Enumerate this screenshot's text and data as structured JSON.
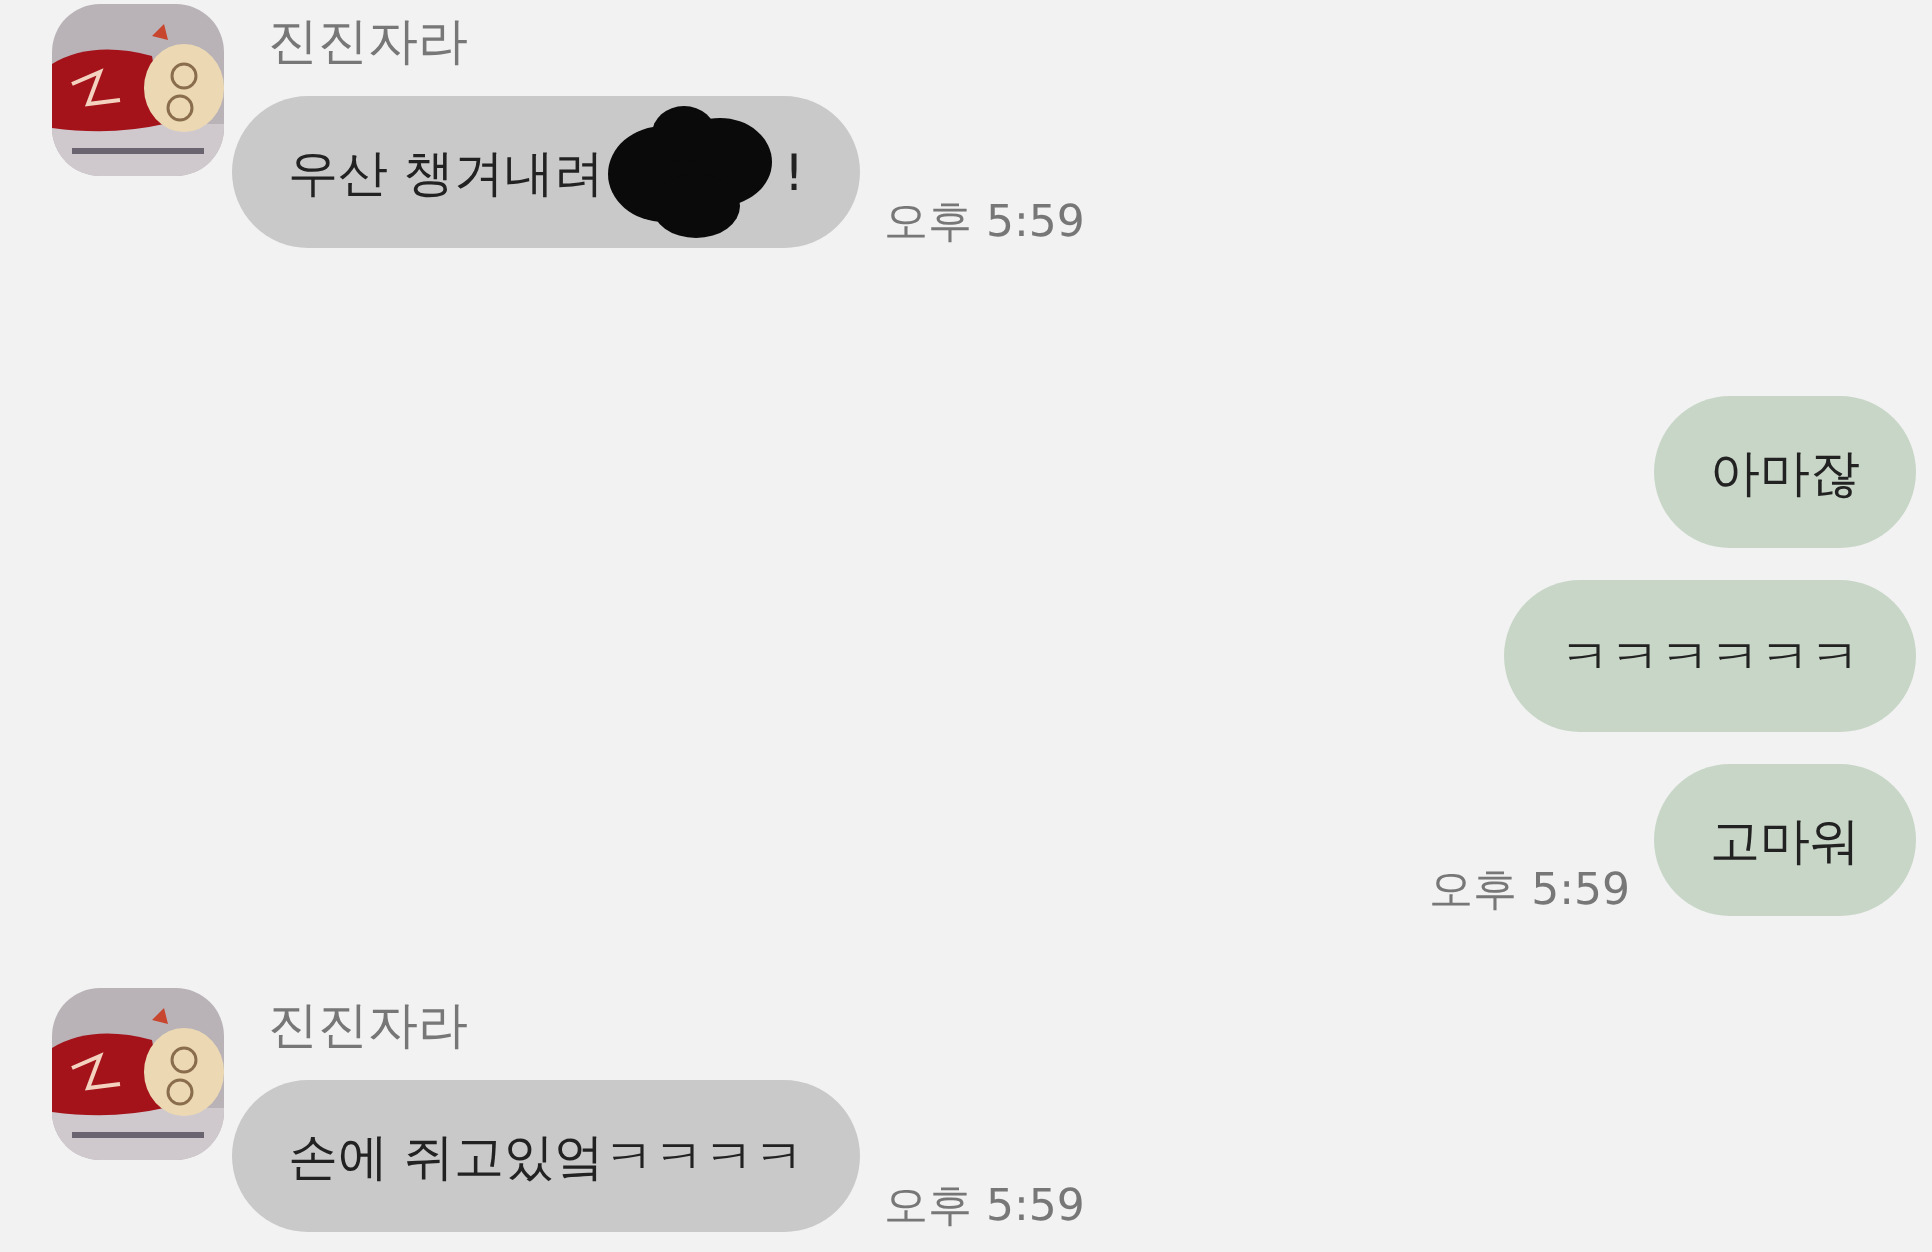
{
  "messages": [
    {
      "kind": "incoming",
      "sender": "진진자라",
      "bubbles": [
        {
          "parts": [
            {
              "kind": "text",
              "text": "우산 챙겨내려"
            },
            {
              "kind": "redaction"
            },
            {
              "kind": "text",
              "text": "!"
            }
          ],
          "time": "오후 5:59"
        }
      ]
    },
    {
      "kind": "outgoing",
      "bubbles": [
        {
          "parts": [
            {
              "kind": "text",
              "text": "아마잖"
            }
          ]
        },
        {
          "parts": [
            {
              "kind": "text",
              "text": "ㅋㅋㅋㅋㅋㅋ"
            }
          ]
        },
        {
          "parts": [
            {
              "kind": "text",
              "text": "고마워"
            }
          ],
          "time": "오후 5:59"
        }
      ]
    },
    {
      "kind": "incoming",
      "sender": "진진자라",
      "bubbles": [
        {
          "parts": [
            {
              "kind": "text",
              "text": "손에 쥐고있엌ㅋㅋㅋㅋ"
            }
          ],
          "time": "오후 5:59"
        }
      ]
    }
  ]
}
